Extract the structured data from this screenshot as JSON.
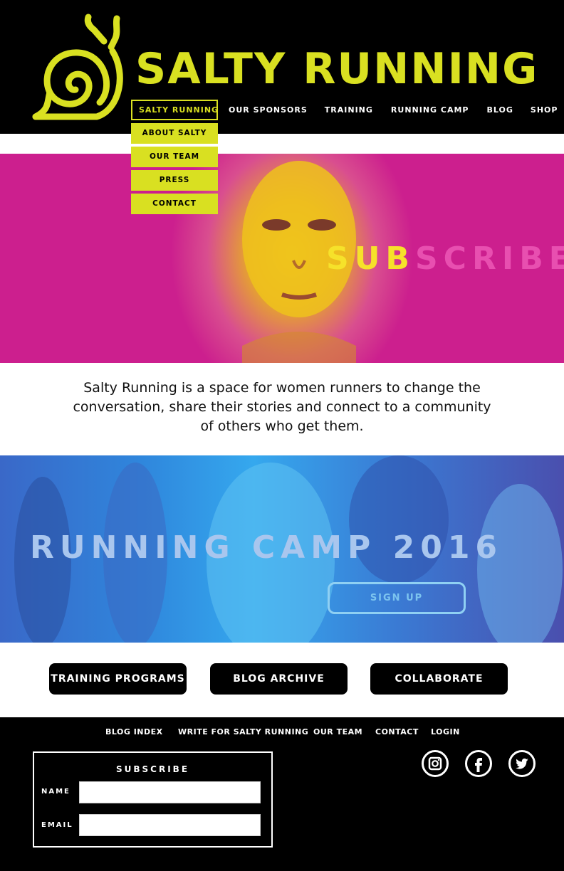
{
  "brand": {
    "name": "SALTY RUNNING",
    "accent": "#d9e021"
  },
  "nav": {
    "items": [
      "SALTY RUNNING",
      "OUR SPONSORS",
      "TRAINING",
      "RUNNING CAMP",
      "BLOG",
      "SHOP"
    ],
    "active": "SALTY RUNNING",
    "dropdown": [
      "ABOUT SALTY",
      "OUR TEAM",
      "PRESS",
      "CONTACT"
    ]
  },
  "hero": {
    "text": "SUBSCRIBE"
  },
  "mission": "Salty Running is a space for women runners to change the conversation, share their stories and connect to a community of others who get them.",
  "camp": {
    "title": "RUNNING CAMP 2016",
    "button": "SIGN UP"
  },
  "buttons": [
    "TRAINING PROGRAMS",
    "BLOG ARCHIVE",
    "COLLABORATE"
  ],
  "footer": {
    "links": [
      "BLOG INDEX",
      "WRITE FOR SALTY RUNNING",
      "OUR TEAM",
      "CONTACT",
      "LOGIN"
    ],
    "subscribe": {
      "title": "SUBSCRIBE",
      "name_label": "NAME",
      "email_label": "EMAIL",
      "name_value": "",
      "email_value": ""
    },
    "social": [
      "instagram-icon",
      "facebook-icon",
      "twitter-icon"
    ]
  }
}
